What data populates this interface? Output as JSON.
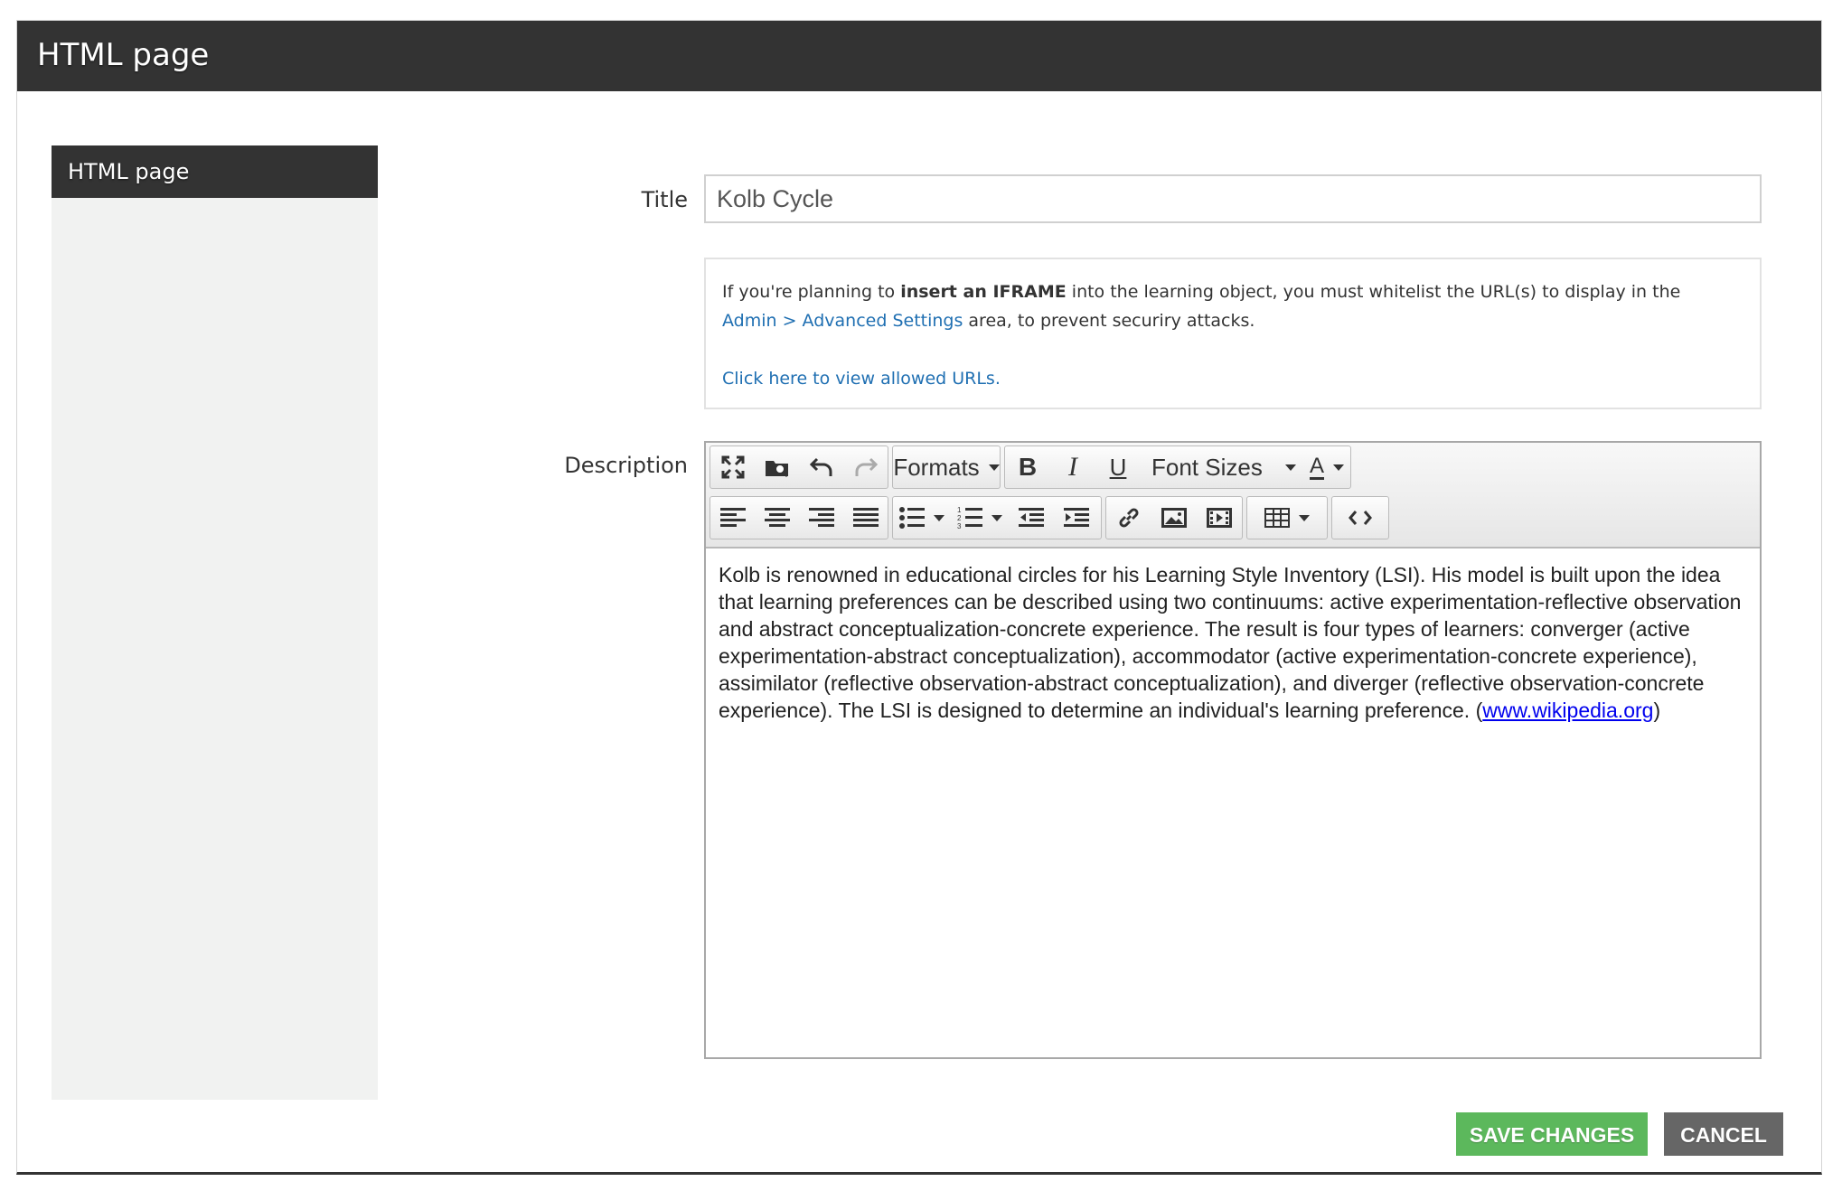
{
  "modal": {
    "title": "HTML page"
  },
  "sidebar": {
    "items": [
      {
        "label": "HTML page"
      }
    ]
  },
  "form": {
    "title_label": "Title",
    "title_value": "Kolb Cycle",
    "description_label": "Description"
  },
  "info": {
    "text_before": "If you're planning to ",
    "text_bold": "insert an IFRAME",
    "text_after": " into the learning object, you must whitelist the URL(s) to display in the",
    "link_admin": "Admin > Advanced Settings",
    "text_end": " area, to prevent securiry attacks.",
    "link_allowed": "Click here to view allowed URLs."
  },
  "toolbar": {
    "formats_label": "Formats",
    "font_sizes_label": "Font Sizes",
    "text_color_letter": "A"
  },
  "editor": {
    "content": "Kolb is renowned in educational circles for his Learning Style Inventory (LSI). His model is built upon the idea that learning preferences can be described using two continuums: active experimentation-reflective observation and abstract conceptualization-concrete experience. The result is four types of learners: converger (active experimentation-abstract conceptualization), accommodator (active experimentation-concrete experience), assimilator (reflective observation-abstract conceptualization), and diverger (reflective observation-concrete experience). The LSI is designed to determine an individual's learning preference. (",
    "link": "www.wikipedia.org",
    "content_end": ")"
  },
  "actions": {
    "save_label": "SAVE CHANGES",
    "cancel_label": "CANCEL"
  },
  "colors": {
    "header": "#333333",
    "save": "#5cb85c",
    "cancel": "#666666",
    "link": "#1f6fb2"
  }
}
